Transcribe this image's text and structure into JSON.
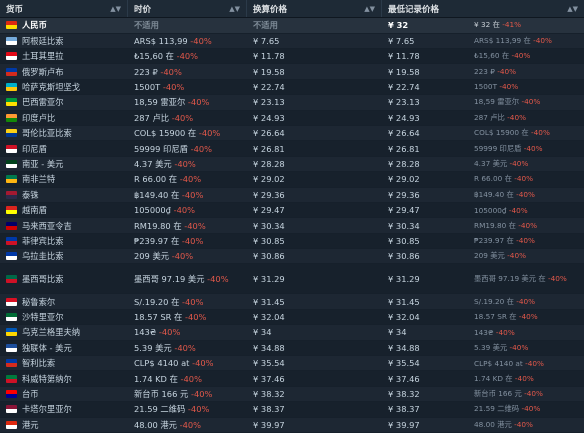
{
  "headers": {
    "currency": "货币",
    "price": "时价",
    "converted": "换算价格",
    "lowest": "最低记录价格"
  },
  "colors": {
    "background": "#1b2838",
    "negative": "#e2584a",
    "muted": "#7d8a96"
  },
  "rows": [
    {
      "name": "人民币",
      "flag_colors": [
        "#de2910",
        "#ffde00"
      ],
      "price": "不适用",
      "price_muted": true,
      "pct": "",
      "converted": "不适用",
      "lowest": "¥ 32",
      "lowest_local": "¥ 32 在",
      "lowest_pct": "-41%",
      "highlight": true
    },
    {
      "name": "阿根廷比索",
      "flag_colors": [
        "#75aadb",
        "#ffffff"
      ],
      "price": "ARS$ 113,99",
      "pct": "-40%",
      "converted": "¥ 7.65",
      "lowest": "¥ 7.65",
      "lowest_local": "ARS$ 113,99 在",
      "lowest_pct": "-40%"
    },
    {
      "name": "土耳其里拉",
      "flag_colors": [
        "#e30a17",
        "#ffffff"
      ],
      "price": "₺15,60 在",
      "pct": "-40%",
      "converted": "¥ 11.78",
      "lowest": "¥ 11.78",
      "lowest_local": "₺15,60 在",
      "lowest_pct": "-40%"
    },
    {
      "name": "俄罗斯卢布",
      "flag_colors": [
        "#0039a6",
        "#d52b1e"
      ],
      "price": "223 ₽",
      "pct": "-40%",
      "converted": "¥ 19.58",
      "lowest": "¥ 19.58",
      "lowest_local": "223 ₽",
      "lowest_pct": "-40%"
    },
    {
      "name": "哈萨克斯坦坚戈",
      "flag_colors": [
        "#00afca",
        "#fec50c"
      ],
      "price": "1500T",
      "pct": "-40%",
      "converted": "¥ 22.74",
      "lowest": "¥ 22.74",
      "lowest_local": "1500T",
      "lowest_pct": "-40%"
    },
    {
      "name": "巴西雷亚尔",
      "flag_colors": [
        "#009c3b",
        "#ffdf00"
      ],
      "price": "18,59 雷亚尔",
      "pct": "-40%",
      "converted": "¥ 23.13",
      "lowest": "¥ 23.13",
      "lowest_local": "18,59 雷亚尔",
      "lowest_pct": "-40%"
    },
    {
      "name": "印度卢比",
      "flag_colors": [
        "#ff9933",
        "#138808"
      ],
      "price": "287 卢比",
      "pct": "-40%",
      "converted": "¥ 24.93",
      "lowest": "¥ 24.93",
      "lowest_local": "287 卢比",
      "lowest_pct": "-40%"
    },
    {
      "name": "哥伦比亚比索",
      "flag_colors": [
        "#fcd116",
        "#003893"
      ],
      "price": "COL$ 15900 在",
      "pct": "-40%",
      "converted": "¥ 26.64",
      "lowest": "¥ 26.64",
      "lowest_local": "COL$ 15900 在",
      "lowest_pct": "-40%"
    },
    {
      "name": "印尼盾",
      "flag_colors": [
        "#ce1126",
        "#ffffff"
      ],
      "price": "59999 印尼盾",
      "pct": "-40%",
      "converted": "¥ 26.81",
      "lowest": "¥ 26.81",
      "lowest_local": "59999 印尼盾",
      "lowest_pct": "-40%"
    },
    {
      "name": "南亚 - 美元",
      "flag_colors": [
        "#01411c",
        "#ffffff"
      ],
      "price": "4.37 美元",
      "pct": "-40%",
      "converted": "¥ 28.28",
      "lowest": "¥ 28.28",
      "lowest_local": "4.37 美元",
      "lowest_pct": "-40%"
    },
    {
      "name": "南非兰特",
      "flag_colors": [
        "#007a4d",
        "#ffb612"
      ],
      "price": "R 66.00 在",
      "pct": "-40%",
      "converted": "¥ 29.02",
      "lowest": "¥ 29.02",
      "lowest_local": "R 66.00 在",
      "lowest_pct": "-40%"
    },
    {
      "name": "泰铢",
      "flag_colors": [
        "#a51931",
        "#2d2a4a"
      ],
      "price": "฿149.40 在",
      "pct": "-40%",
      "converted": "¥ 29.36",
      "lowest": "¥ 29.36",
      "lowest_local": "฿149.40 在",
      "lowest_pct": "-40%"
    },
    {
      "name": "越南盾",
      "flag_colors": [
        "#da251d",
        "#ffff00"
      ],
      "price": "105000₫",
      "pct": "-40%",
      "converted": "¥ 29.47",
      "lowest": "¥ 29.47",
      "lowest_local": "105000₫",
      "lowest_pct": "-40%"
    },
    {
      "name": "马来西亚令吉",
      "flag_colors": [
        "#010066",
        "#cc0001"
      ],
      "price": "RM19.80 在",
      "pct": "-40%",
      "converted": "¥ 30.34",
      "lowest": "¥ 30.34",
      "lowest_local": "RM19.80 在",
      "lowest_pct": "-40%"
    },
    {
      "name": "菲律宾比索",
      "flag_colors": [
        "#0038a8",
        "#ce1126"
      ],
      "price": "₱239.97 在",
      "pct": "-40%",
      "converted": "¥ 30.85",
      "lowest": "¥ 30.85",
      "lowest_local": "₱239.97 在",
      "lowest_pct": "-40%"
    },
    {
      "name": "乌拉圭比索",
      "flag_colors": [
        "#0038a8",
        "#ffffff"
      ],
      "price": "209 美元",
      "pct": "-40%",
      "converted": "¥ 30.86",
      "lowest": "¥ 30.86",
      "lowest_local": "209 美元",
      "lowest_pct": "-40%"
    },
    {
      "name": "墨西哥比索",
      "flag_colors": [
        "#006847",
        "#ce1126"
      ],
      "price": "墨西哥 97.19 美元",
      "pct": "-40%",
      "converted": "¥ 31.29",
      "lowest": "¥ 31.29",
      "lowest_local": "墨西哥 97.19 美元 在",
      "lowest_pct": "-40%",
      "tall": true
    },
    {
      "name": "秘鲁索尔",
      "flag_colors": [
        "#d91023",
        "#ffffff"
      ],
      "price": "S/.19.20 在",
      "pct": "-40%",
      "converted": "¥ 31.45",
      "lowest": "¥ 31.45",
      "lowest_local": "S/.19.20 在",
      "lowest_pct": "-40%"
    },
    {
      "name": "沙特里亚尔",
      "flag_colors": [
        "#006c35",
        "#ffffff"
      ],
      "price": "18.57 SR 在",
      "pct": "-40%",
      "converted": "¥ 32.04",
      "lowest": "¥ 32.04",
      "lowest_local": "18.57 SR 在",
      "lowest_pct": "-40%"
    },
    {
      "name": "乌克兰格里夫纳",
      "flag_colors": [
        "#0057b7",
        "#ffd700"
      ],
      "price": "143₴",
      "pct": "-40%",
      "converted": "¥ 34",
      "lowest": "¥ 34",
      "lowest_local": "143₴",
      "lowest_pct": "-40%"
    },
    {
      "name": "独联体 - 美元",
      "flag_colors": [
        "#1c4e9c",
        "#ffffff"
      ],
      "price": "5.39 美元",
      "pct": "-40%",
      "converted": "¥ 34.88",
      "lowest": "¥ 34.88",
      "lowest_local": "5.39 美元",
      "lowest_pct": "-40%"
    },
    {
      "name": "智利比索",
      "flag_colors": [
        "#0039a6",
        "#d52b1e"
      ],
      "price": "CLP$ 4140 at",
      "pct": "-40%",
      "converted": "¥ 35.54",
      "lowest": "¥ 35.54",
      "lowest_local": "CLP$ 4140 at",
      "lowest_pct": "-40%"
    },
    {
      "name": "科威特第纳尔",
      "flag_colors": [
        "#007a3d",
        "#ce1126"
      ],
      "price": "1.74 KD 在",
      "pct": "-40%",
      "converted": "¥ 37.46",
      "lowest": "¥ 37.46",
      "lowest_local": "1.74 KD 在",
      "lowest_pct": "-40%"
    },
    {
      "name": "台币",
      "flag_colors": [
        "#fe0000",
        "#000095"
      ],
      "price": "新台币 166 元",
      "pct": "-40%",
      "converted": "¥ 38.32",
      "lowest": "¥ 38.32",
      "lowest_local": "新台币 166 元",
      "lowest_pct": "-40%"
    },
    {
      "name": "卡塔尔里亚尔",
      "flag_colors": [
        "#8a1538",
        "#ffffff"
      ],
      "price": "21.59 二维码",
      "pct": "-40%",
      "converted": "¥ 38.37",
      "lowest": "¥ 38.37",
      "lowest_local": "21.59 二维码",
      "lowest_pct": "-40%"
    },
    {
      "name": "港元",
      "flag_colors": [
        "#de2910",
        "#ffffff"
      ],
      "price": "48.00 港元",
      "pct": "-40%",
      "converted": "¥ 39.97",
      "lowest": "¥ 39.97",
      "lowest_local": "48.00 港元",
      "lowest_pct": "-40%"
    }
  ]
}
